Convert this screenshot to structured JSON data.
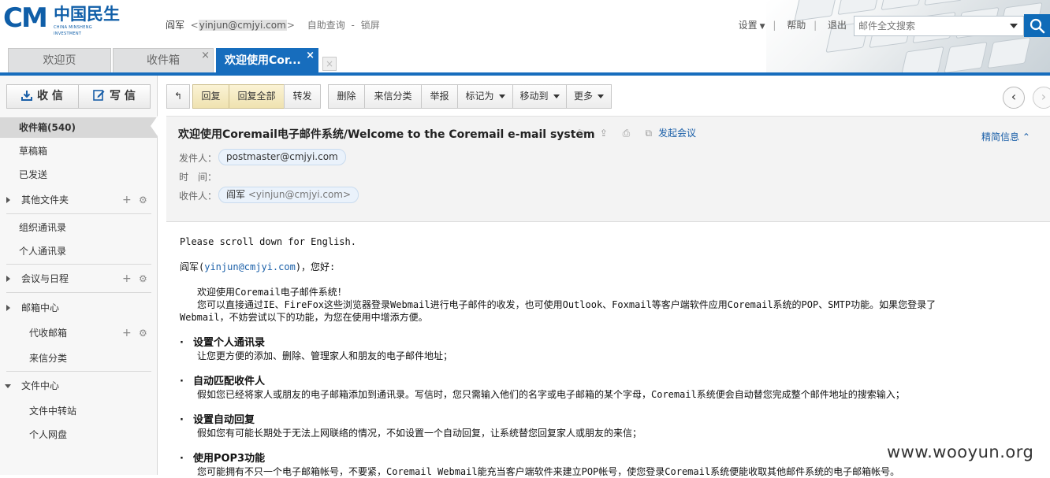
{
  "logo": {
    "mark": "CM",
    "cn": "中国民生",
    "en": "CHINA MINSHENG INVESTMENT"
  },
  "user": {
    "name": "阎军",
    "email": "yinjun@cmjyi.com",
    "self_service": "自助查询",
    "separator": "-",
    "lock": "锁屏"
  },
  "topbar": {
    "settings": "设置",
    "help": "帮助",
    "logout": "退出",
    "search_placeholder": "邮件全文搜索",
    "sep": "|"
  },
  "tabs": [
    {
      "label": "欢迎页"
    },
    {
      "label": "收件箱",
      "close": "×"
    },
    {
      "label": "欢迎使用Cor...",
      "close": "×"
    }
  ],
  "tab_new": "×",
  "sidebar": {
    "receive": "收 信",
    "compose": "写 信",
    "items": [
      {
        "label": "收件箱(540)"
      },
      {
        "label": "草稿箱"
      },
      {
        "label": "已发送"
      },
      {
        "label": "其他文件夹"
      },
      {
        "label": "组织通讯录"
      },
      {
        "label": "个人通讯录"
      },
      {
        "label": "会议与日程"
      },
      {
        "label": "邮箱中心"
      },
      {
        "label": "代收邮箱"
      },
      {
        "label": "来信分类"
      },
      {
        "label": "文件中心"
      },
      {
        "label": "文件中转站"
      },
      {
        "label": "个人网盘"
      }
    ]
  },
  "toolbar": {
    "back": "↰",
    "reply": "回复",
    "reply_all": "回复全部",
    "forward": "转发",
    "delete": "删除",
    "classify": "来信分类",
    "report": "举报",
    "mark_as": "标记为",
    "move_to": "移动到",
    "more": "更多",
    "prev": "‹",
    "next": "›"
  },
  "message": {
    "subject": "欢迎使用Coremail电子邮件系统/Welcome to the Coremail e-mail system",
    "start_meeting": "发起会议",
    "brief_info": "精简信息",
    "from_label": "发件人：",
    "from": "postmaster@cmjyi.com",
    "time_label": "时　间：",
    "to_label": "收件人：",
    "to_name": "阎军",
    "to_email": "<yinjun@cmjyi.com>"
  },
  "body": {
    "line1": "Please scroll down for English.",
    "greet_name": "阎军(",
    "greet_email": "yinjun@cmjyi.com",
    "greet_tail": ")，您好:",
    "welcome": "欢迎使用Coremail电子邮件系统！",
    "intro": "您可以直接通过IE、FireFox这些浏览器登录Webmail进行电子邮件的收发，也可使用Outlook、Foxmail等客户端软件应用Coremail系统的POP、SMTP功能。如果您登录了",
    "intro2": "Webmail，不妨尝试以下的功能，为您在使用中增添方便。",
    "bullet": "·",
    "features": [
      {
        "title": "设置个人通讯录",
        "desc": "让您更方便的添加、删除、管理家人和朋友的电子邮件地址；"
      },
      {
        "title": "自动匹配收件人",
        "desc": "假如您已经将家人或朋友的电子邮箱添加到通讯录。写信时，您只需输入他们的名字或电子邮箱的某个字母，Coremail系统便会自动替您完成整个邮件地址的搜索输入；"
      },
      {
        "title": "设置自动回复",
        "desc": "假如您有可能长期处于无法上网联络的情况，不如设置一个自动回复，让系统替您回复家人或朋友的来信；"
      },
      {
        "title": "使用POP3功能",
        "desc": "您可能拥有不只一个电子邮箱帐号，不要紧，Coremail Webmail能充当客户端软件来建立POP帐号，使您登录Coremail系统便能收取其他邮件系统的电子邮箱帐号。"
      }
    ]
  },
  "watermark": "www.wooyun.org",
  "colors": {
    "brand": "#0f5ea8",
    "tab_active": "#176dbd",
    "link": "#1a5fa8"
  }
}
